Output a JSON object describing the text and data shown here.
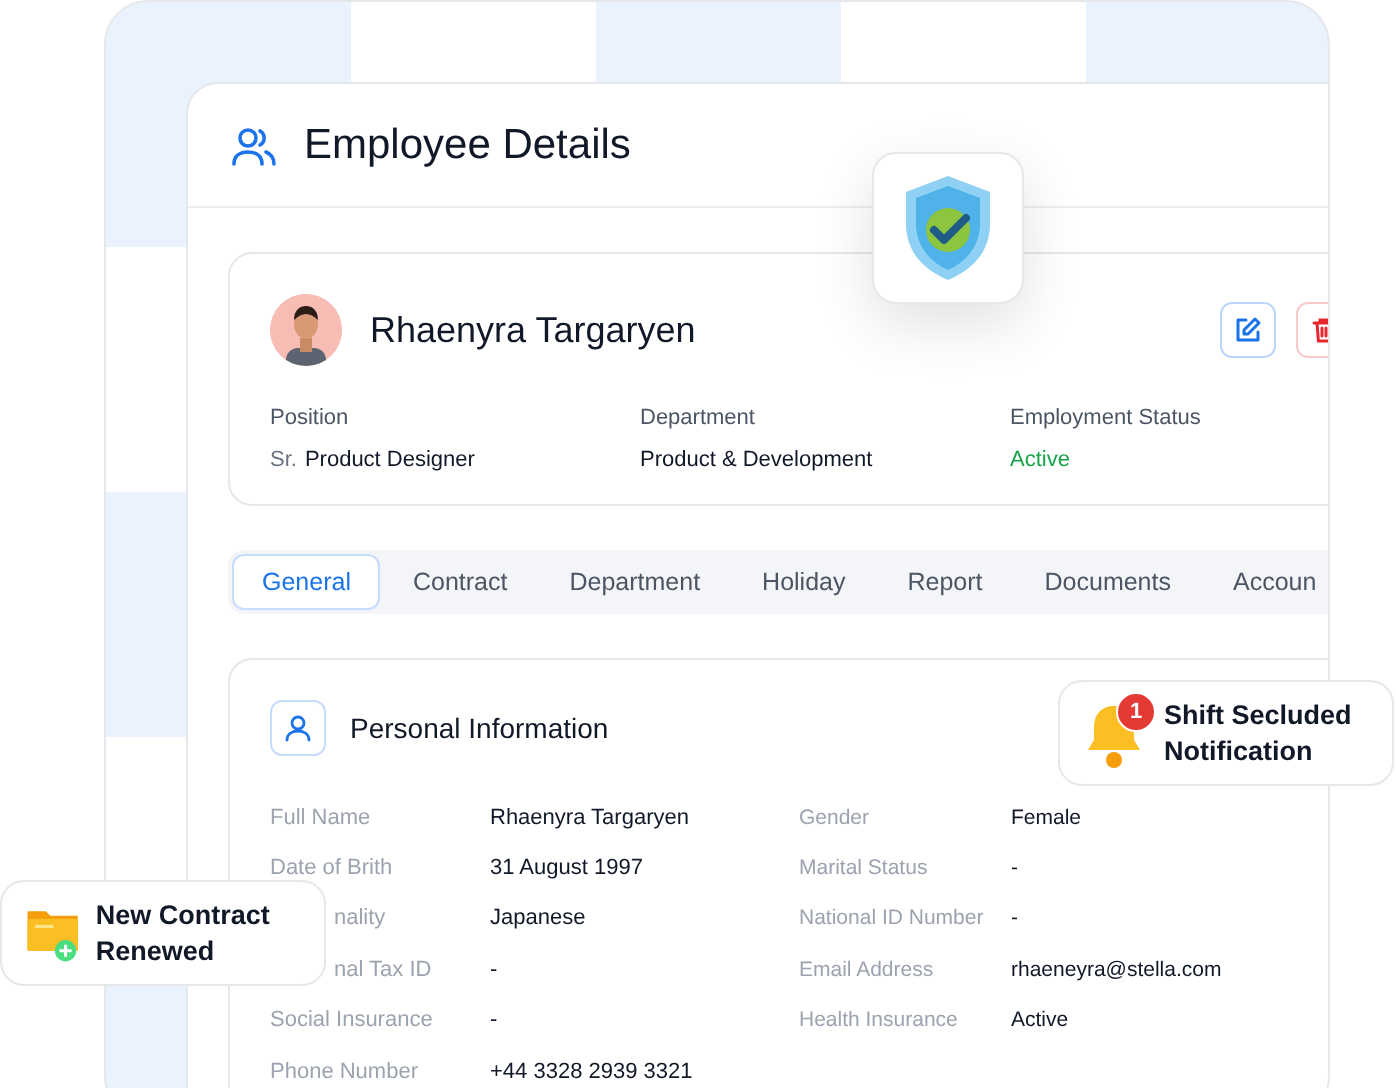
{
  "header": {
    "title": "Employee Details"
  },
  "profile": {
    "name": "Rhaenyra Targaryen",
    "fields": [
      {
        "label": "Position",
        "prefix": "Sr.",
        "value": "Product Designer",
        "kind": "text"
      },
      {
        "label": "Department",
        "value": "Product & Development",
        "kind": "text"
      },
      {
        "label": "Employment Status",
        "value": "Active",
        "kind": "status"
      }
    ]
  },
  "tabs": [
    {
      "label": "General",
      "selected": true
    },
    {
      "label": "Contract",
      "selected": false
    },
    {
      "label": "Department",
      "selected": false
    },
    {
      "label": "Holiday",
      "selected": false
    },
    {
      "label": "Report",
      "selected": false
    },
    {
      "label": "Documents",
      "selected": false
    },
    {
      "label": "Accoun",
      "selected": false
    }
  ],
  "personal": {
    "title": "Personal Information",
    "left": [
      {
        "label": "Full Name",
        "value": "Rhaenyra Targaryen",
        "covered": false
      },
      {
        "label": "Date of Brith",
        "value": "31 August 1997",
        "covered": false
      },
      {
        "label": "nality",
        "value": "Japanese",
        "covered": true
      },
      {
        "label": "nal Tax ID",
        "value": "-",
        "covered": true
      },
      {
        "label": "Social Insurance",
        "value": "-",
        "covered": false
      },
      {
        "label": "Phone Number",
        "value": "+44 3328 2939 3321",
        "covered": false
      }
    ],
    "right": [
      {
        "label": "Gender",
        "value": "Female",
        "covered": false
      },
      {
        "label": "Marital Status",
        "value": "-",
        "covered": false
      },
      {
        "label": "National ID Number",
        "value": "-",
        "covered": false
      },
      {
        "label": "Email Address",
        "value": "rhaeneyra@stella.com",
        "covered": false
      },
      {
        "label": "Health Insurance",
        "value": "Active",
        "covered": false
      }
    ]
  },
  "notification": {
    "count": "1",
    "title": "Shift Secluded Notification"
  },
  "contract": {
    "title": "New Contract Renewed"
  }
}
